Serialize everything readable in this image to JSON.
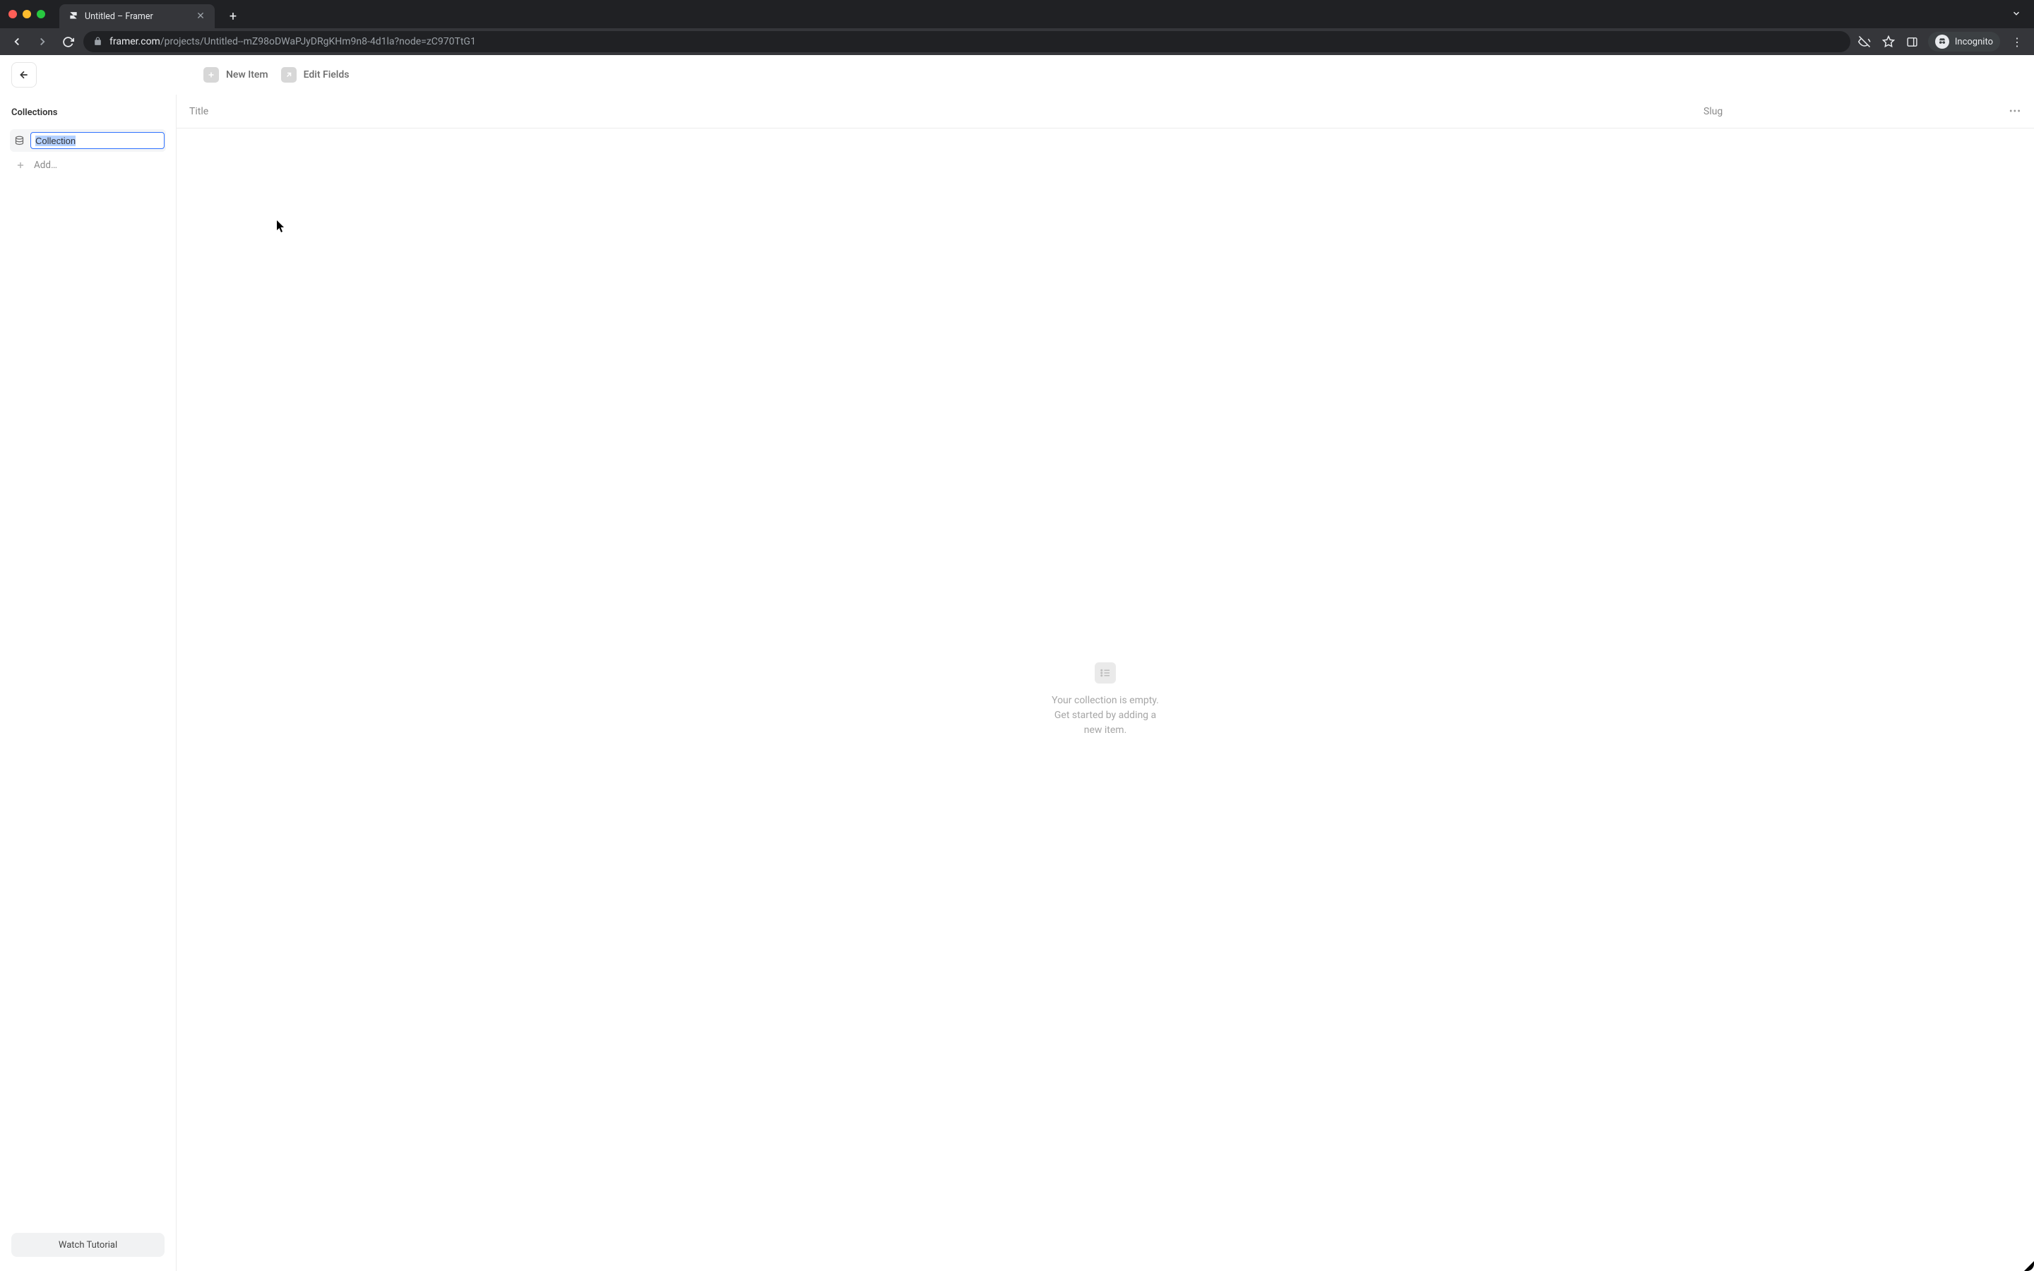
{
  "browser": {
    "tab_title": "Untitled – Framer",
    "url_host": "framer.com",
    "url_path": "/projects/Untitled--mZ98oDWaPJyDRgKHm9n8-4d1la?node=zC970TtG1",
    "incognito_label": "Incognito"
  },
  "toolbar": {
    "new_item_label": "New Item",
    "edit_fields_label": "Edit Fields"
  },
  "sidebar": {
    "heading": "Collections",
    "collection_name": "Collection",
    "add_label": "Add…",
    "tutorial_label": "Watch Tutorial"
  },
  "table": {
    "col_title": "Title",
    "col_slug": "Slug"
  },
  "empty": {
    "message": "Your collection is empty. Get started by adding a new item."
  }
}
